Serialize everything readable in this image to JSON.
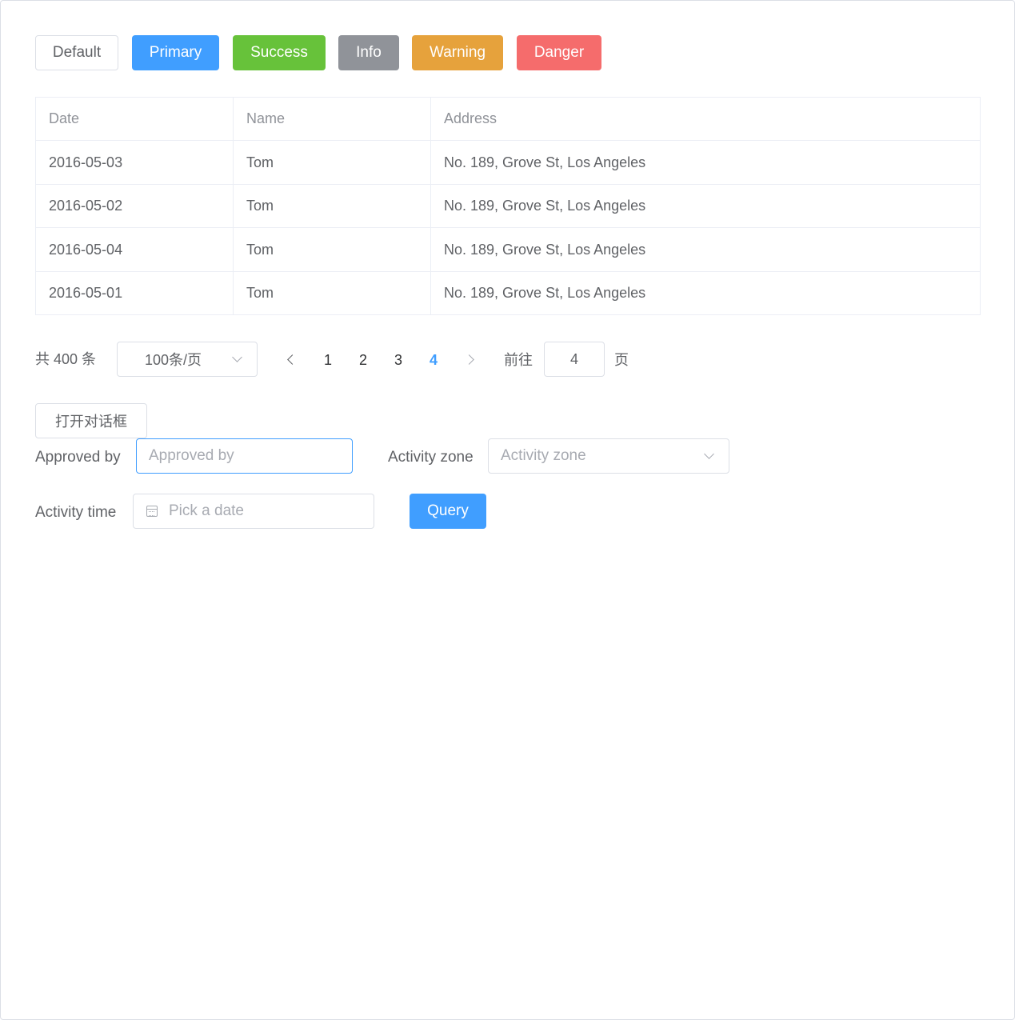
{
  "buttons": {
    "default": "Default",
    "primary": "Primary",
    "success": "Success",
    "info": "Info",
    "warning": "Warning",
    "danger": "Danger"
  },
  "colors": {
    "primary": "#409eff",
    "success": "#67c23a",
    "info": "#909399",
    "warning": "#e6a23c",
    "danger": "#f56c6c"
  },
  "table": {
    "headers": [
      "Date",
      "Name",
      "Address"
    ],
    "rows": [
      [
        "2016-05-03",
        "Tom",
        "No. 189, Grove St, Los Angeles"
      ],
      [
        "2016-05-02",
        "Tom",
        "No. 189, Grove St, Los Angeles"
      ],
      [
        "2016-05-04",
        "Tom",
        "No. 189, Grove St, Los Angeles"
      ],
      [
        "2016-05-01",
        "Tom",
        "No. 189, Grove St, Los Angeles"
      ]
    ]
  },
  "pagination": {
    "total": "共 400 条",
    "page_size": "100条/页",
    "pages": [
      "1",
      "2",
      "3",
      "4"
    ],
    "current_page": "4",
    "goto_label": "前往",
    "goto_value": "4",
    "page_suffix": "页"
  },
  "dialog_button": "打开对话框",
  "form": {
    "approved_by_label": "Approved by",
    "approved_by_placeholder": "Approved by",
    "activity_zone_label": "Activity zone",
    "activity_zone_placeholder": "Activity zone",
    "activity_time_label": "Activity time",
    "activity_time_placeholder": "Pick a date",
    "query_button": "Query"
  }
}
